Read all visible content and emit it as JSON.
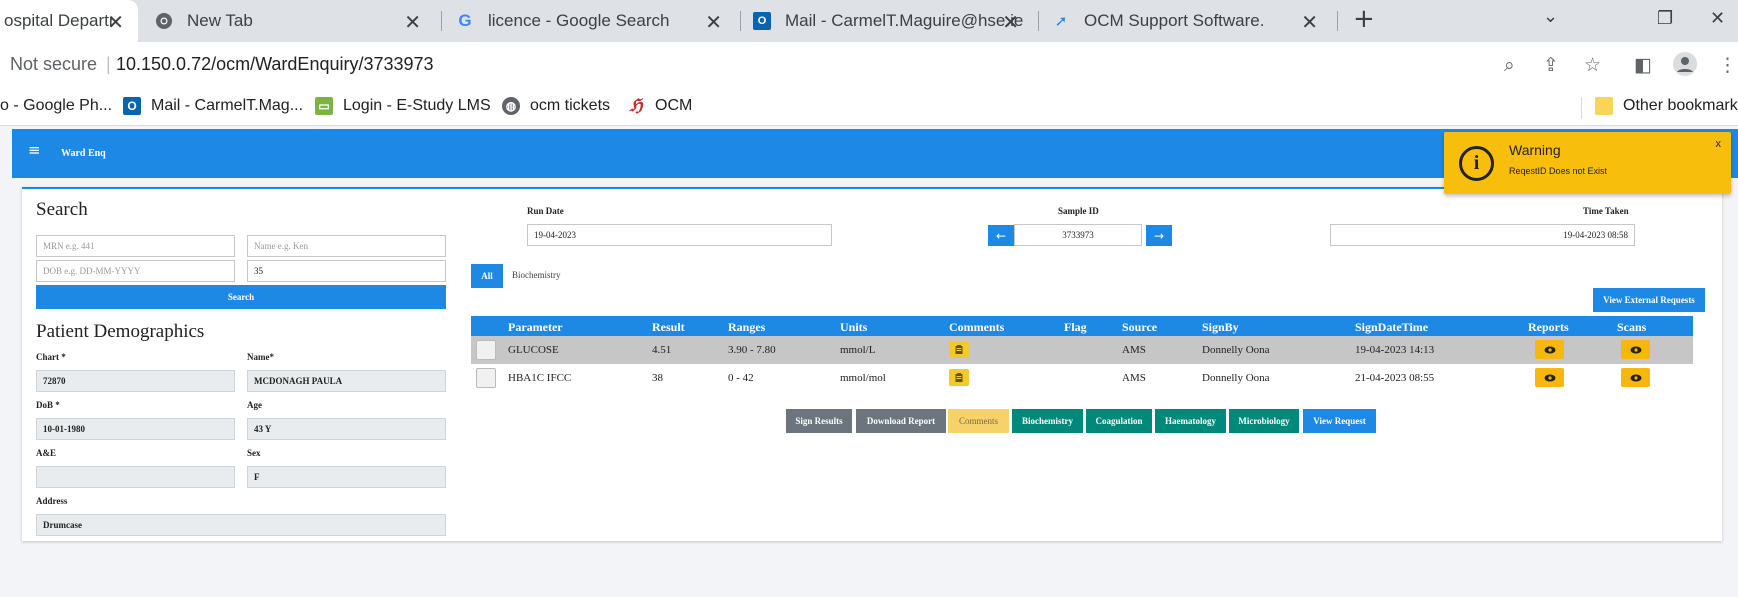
{
  "browser": {
    "tabs": [
      {
        "title": "ospital Departm"
      },
      {
        "title": "New Tab"
      },
      {
        "title": "licence - Google Search"
      },
      {
        "title": "Mail - CarmelT.Maguire@hse.ie"
      },
      {
        "title": "OCM Support Software."
      }
    ],
    "security_label": "Not secure",
    "url": "10.150.0.72/ocm/WardEnquiry/3733973",
    "bookmarks": [
      {
        "label": "o - Google Ph..."
      },
      {
        "label": "Mail - CarmelT.Mag..."
      },
      {
        "label": "Login - E-Study LMS"
      },
      {
        "label": "ocm tickets"
      },
      {
        "label": "OCM"
      }
    ],
    "other_bookmarks": "Other bookmarks"
  },
  "app": {
    "title": "Ward Enq"
  },
  "toast": {
    "title": "Warning",
    "message": "ReqestID Does not Exist",
    "close": "x"
  },
  "search": {
    "title": "Search",
    "mrn_placeholder": "MRN e.g. 441",
    "name_placeholder": "Name e.g. Ken",
    "dob_placeholder": "DOB e.g. DD-MM-YYYY",
    "extra_value": "35",
    "button_label": "Search"
  },
  "demographics": {
    "title": "Patient Demographics",
    "chart_label": "Chart *",
    "chart_value": "72870",
    "name_label": "Name*",
    "name_value": "MCDONAGH PAULA",
    "dob_label": "DoB *",
    "dob_value": "10-01-1980",
    "age_label": "Age",
    "age_value": "43 Y",
    "ae_label": "A&E",
    "ae_value": "",
    "sex_label": "Sex",
    "sex_value": "F",
    "address_label": "Address",
    "address_value": "Drumcase"
  },
  "run": {
    "run_date_label": "Run Date",
    "run_date_value": "19-04-2023",
    "sample_id_label": "Sample ID",
    "sample_id_value": "3733973",
    "time_taken_label": "Time Taken",
    "time_taken_value": "19-04-2023 08:58"
  },
  "filter_tabs": {
    "all": "All",
    "biochemistry": "Biochemistry"
  },
  "view_external_label": "View External Requests",
  "results": {
    "headers": [
      "Parameter",
      "Result",
      "Ranges",
      "Units",
      "Comments",
      "Flag",
      "Source",
      "SignBy",
      "SignDateTime",
      "Reports",
      "Scans"
    ],
    "rows": [
      {
        "parameter": "GLUCOSE",
        "result": "4.51",
        "ranges": "3.90 - 7.80",
        "units": "mmol/L",
        "flag": "",
        "source": "AMS",
        "sign_by": "Donnelly Oona",
        "sign_datetime": "19-04-2023 14:13"
      },
      {
        "parameter": "HBA1C IFCC",
        "result": "38",
        "ranges": "0 - 42",
        "units": "mmol/mol",
        "flag": "",
        "source": "AMS",
        "sign_by": "Donnelly Oona",
        "sign_datetime": "21-04-2023 08:55"
      }
    ]
  },
  "actions": {
    "sign_results": "Sign Results",
    "download_report": "Download Report",
    "comments": "Comments",
    "biochemistry": "Biochemistry",
    "coagulation": "Coagulation",
    "haematology": "Haematology",
    "microbiology": "Microbiology",
    "view_request": "View Request"
  },
  "colors": {
    "primary": "#1e88e5",
    "warning": "#f8be0c",
    "teal": "#00897b",
    "grey": "#6c757d",
    "comments": "#f6d36a"
  }
}
